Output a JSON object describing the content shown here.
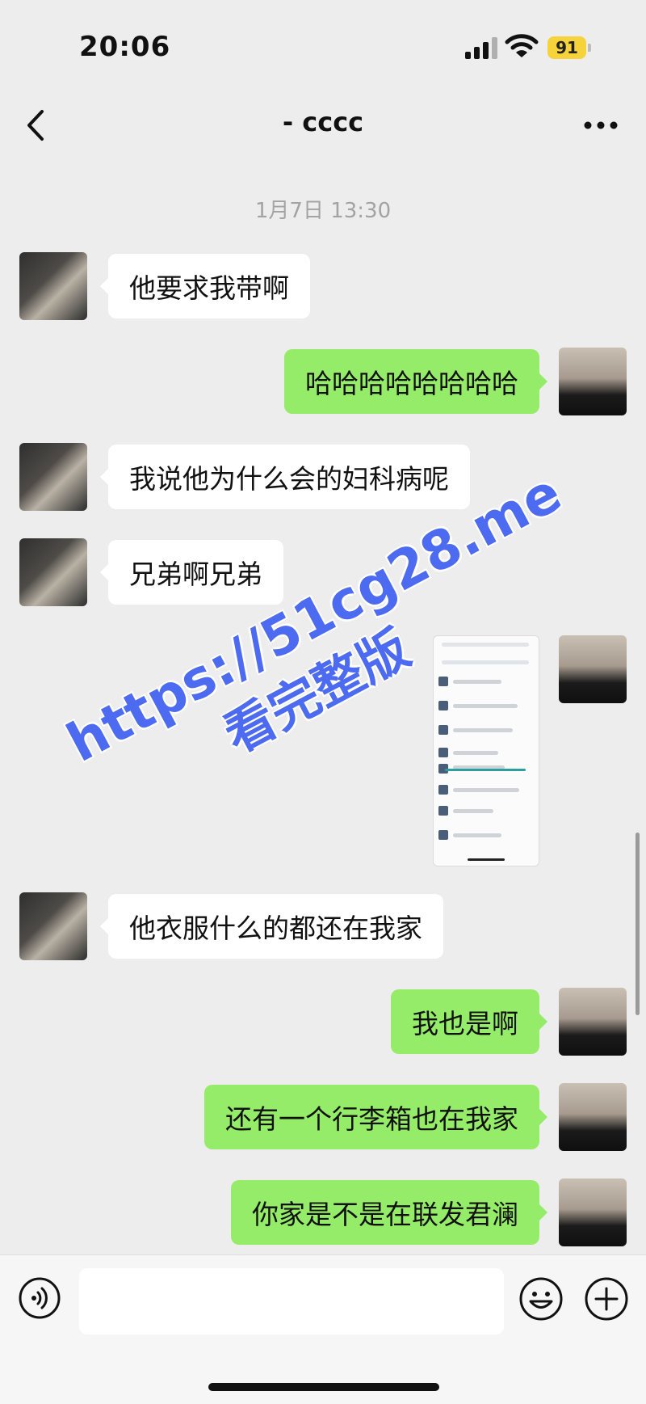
{
  "status_bar": {
    "time": "20:06",
    "battery": "91"
  },
  "nav": {
    "title": "- cccc"
  },
  "timestamp": "1月7日 13:30",
  "messages": [
    {
      "from": "other",
      "text": "他要求我带啊"
    },
    {
      "from": "me",
      "text": "哈哈哈哈哈哈哈哈"
    },
    {
      "from": "other",
      "text": "我说他为什么会的妇科病呢"
    },
    {
      "from": "other",
      "text": "兄弟啊兄弟"
    },
    {
      "from": "me",
      "type": "image"
    },
    {
      "from": "other",
      "text": "他衣服什么的都还在我家"
    },
    {
      "from": "me",
      "text": "我也是啊"
    },
    {
      "from": "me",
      "text": "还有一个行李箱也在我家"
    },
    {
      "from": "me",
      "text": "你家是不是在联发君澜"
    }
  ],
  "watermark": {
    "line1": "https://51cg28.me",
    "line2": "看完整版"
  },
  "input": {
    "value": ""
  },
  "colors": {
    "background": "#ededed",
    "incoming_bubble": "#ffffff",
    "outgoing_bubble": "#95ec69",
    "watermark": "#4c6bf0",
    "battery": "#f6d33a"
  },
  "icons": [
    "back-arrow-icon",
    "more-icon",
    "voice-icon",
    "emoji-icon",
    "plus-icon",
    "signal-icon",
    "wifi-icon",
    "battery-icon"
  ]
}
